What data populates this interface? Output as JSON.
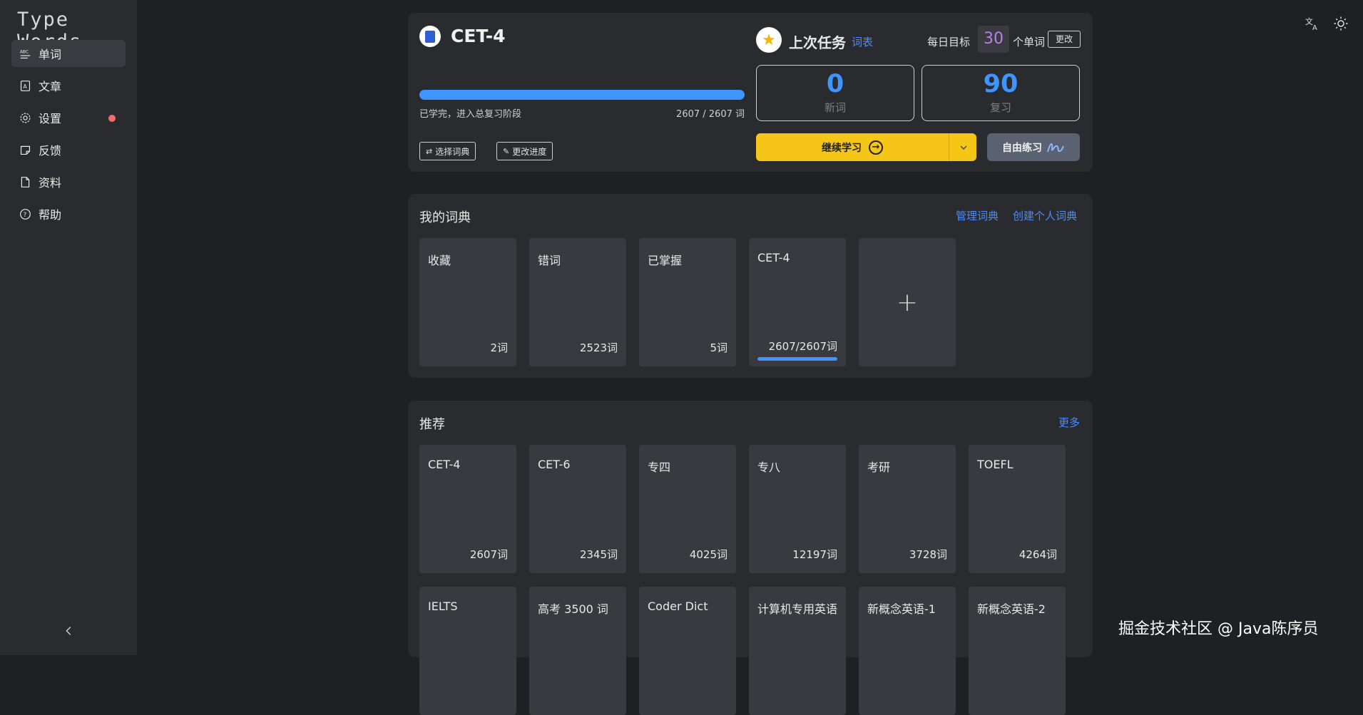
{
  "app": {
    "logo": "Type Words"
  },
  "sidebar": {
    "items": [
      {
        "label": "单词",
        "icon": "abc-icon",
        "active": true
      },
      {
        "label": "文章",
        "icon": "article-icon"
      },
      {
        "label": "设置",
        "icon": "gear-icon",
        "badge": "red-dot"
      },
      {
        "label": "反馈",
        "icon": "feedback-icon"
      },
      {
        "label": "资料",
        "icon": "file-icon"
      },
      {
        "label": "帮助",
        "icon": "help-icon"
      }
    ]
  },
  "topbar": {
    "icons": [
      "translate-icon",
      "theme-sun-icon"
    ]
  },
  "current_book": {
    "title": "CET-4",
    "progress": 1.0,
    "status_text": "已学完，进入总复习阶段",
    "count_text": "2607 / 2607 词",
    "select_dict_label": "选择词典",
    "change_progress_label": "更改进度"
  },
  "task": {
    "title": "上次任务",
    "wordlist_link": "词表",
    "daily_goal_label": "每日目标",
    "daily_goal_value": "30",
    "daily_goal_unit": "个单词",
    "change_label": "更改",
    "new_words": {
      "value": "0",
      "label": "新词"
    },
    "review": {
      "value": "90",
      "label": "复习"
    },
    "continue_label": "继续学习",
    "free_practice_label": "自由练习"
  },
  "my_dicts": {
    "title": "我的词典",
    "manage_label": "管理词典",
    "create_label": "创建个人词典",
    "items": [
      {
        "name": "收藏",
        "count": "2词"
      },
      {
        "name": "错词",
        "count": "2523词"
      },
      {
        "name": "已掌握",
        "count": "5词"
      },
      {
        "name": "CET-4",
        "count": "2607/2607词",
        "progress": 1.0
      }
    ],
    "add_label": "+"
  },
  "recommend": {
    "title": "推荐",
    "more_label": "更多",
    "row1": [
      {
        "name": "CET-4",
        "count": "2607词"
      },
      {
        "name": "CET-6",
        "count": "2345词"
      },
      {
        "name": "专四",
        "count": "4025词"
      },
      {
        "name": "专八",
        "count": "12197词"
      },
      {
        "name": "考研",
        "count": "3728词"
      },
      {
        "name": "TOEFL",
        "count": "4264词"
      }
    ],
    "row2": [
      {
        "name": "IELTS"
      },
      {
        "name": "高考 3500 词"
      },
      {
        "name": "Coder Dict"
      },
      {
        "name": "计算机专用英语"
      },
      {
        "name": "新概念英语-1"
      },
      {
        "name": "新概念英语-2"
      }
    ]
  },
  "watermark": "掘金技术社区 @ Java陈序员",
  "colors": {
    "accent": "#4096ff",
    "primary_button": "#f5c518",
    "goal_number": "#b97de8",
    "badge": "#f46c6c"
  }
}
